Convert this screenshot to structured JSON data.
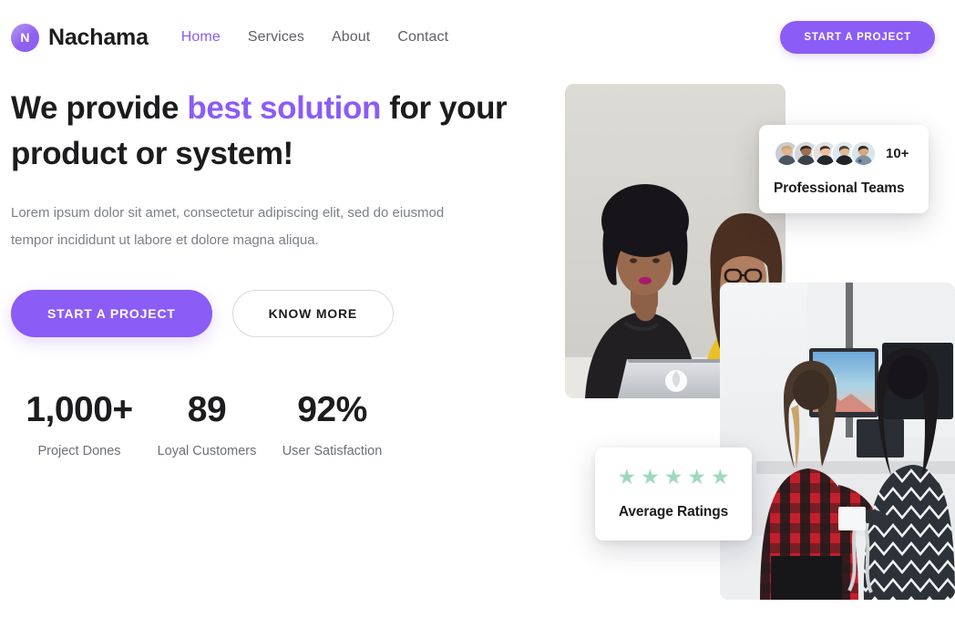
{
  "header": {
    "brand_initial": "N",
    "brand_name": "Nachama",
    "nav": [
      {
        "label": "Home",
        "active": true
      },
      {
        "label": "Services",
        "active": false
      },
      {
        "label": "About",
        "active": false
      },
      {
        "label": "Contact",
        "active": false
      }
    ],
    "cta_label": "START A PROJECT"
  },
  "hero": {
    "headline_part1": "We provide ",
    "headline_accent": "best solution",
    "headline_part2": " for your product or system!",
    "subtext": "Lorem ipsum dolor sit amet, consectetur adipiscing elit, sed do eiusmod tempor incididunt ut labore et dolore magna aliqua.",
    "primary_cta": "START A PROJECT",
    "secondary_cta": "KNOW MORE",
    "stats": [
      {
        "value": "1,000+",
        "label": "Project Dones"
      },
      {
        "value": "89",
        "label": "Loyal Customers"
      },
      {
        "value": "92%",
        "label": "User Satisfaction"
      }
    ]
  },
  "cards": {
    "teams": {
      "count": "10+",
      "title": "Professional Teams",
      "avatar_count": 5
    },
    "ratings": {
      "stars": "★★★★★",
      "star_count": 5,
      "title": "Average Ratings"
    }
  },
  "media": {
    "photo_top_alt": "two-women-at-laptop-photo",
    "photo_bottom_alt": "two-people-at-monitors-photo"
  },
  "colors": {
    "accent": "#8b5cf6",
    "text_dark": "#1c1c1e",
    "text_muted": "#7b7f88",
    "star": "#9fd9bc",
    "background": "#ffffff"
  }
}
